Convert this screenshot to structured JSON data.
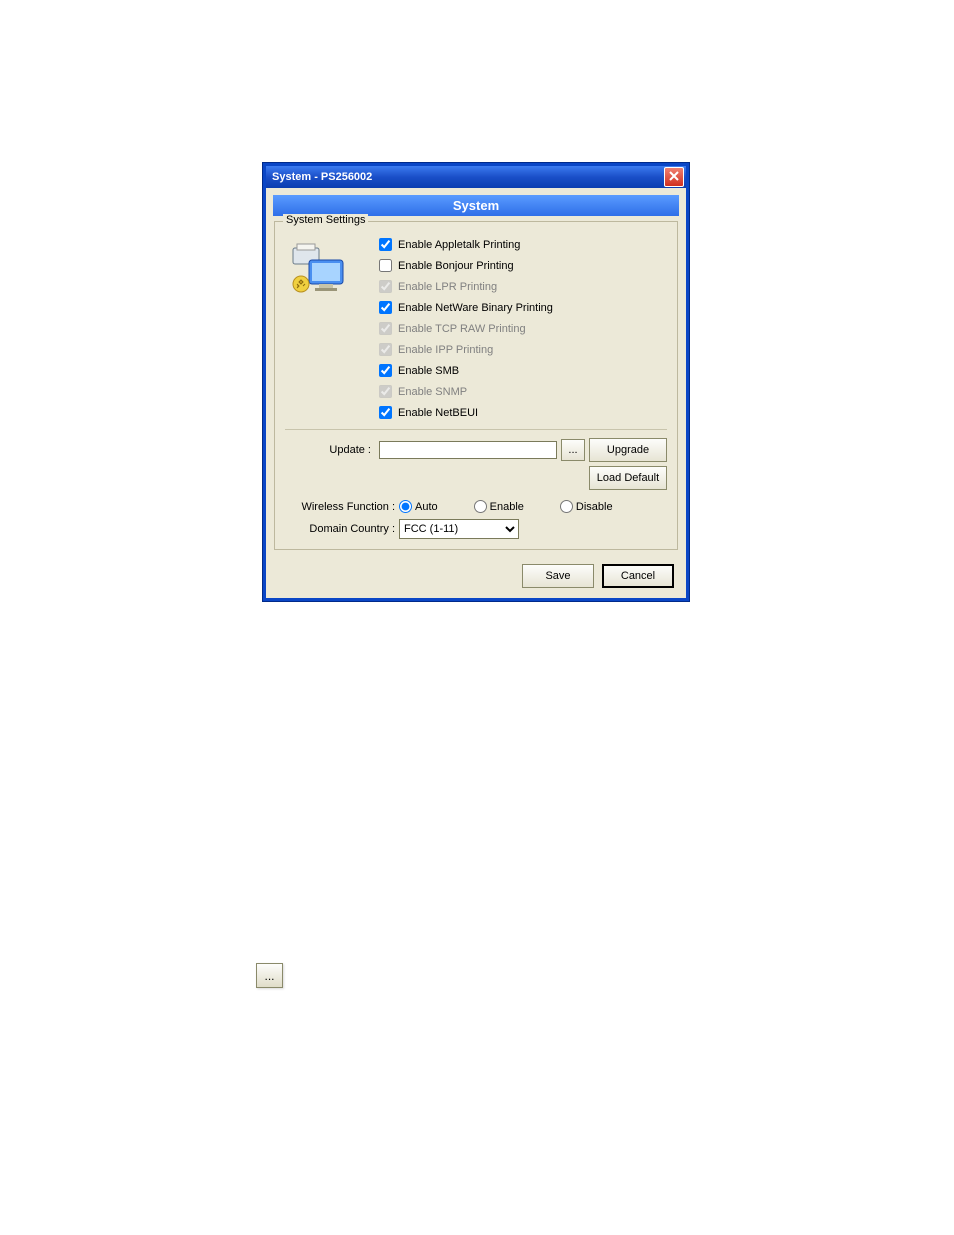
{
  "window": {
    "title": "System - PS256002",
    "banner": "System"
  },
  "group": {
    "legend": "System Settings"
  },
  "checkboxes": [
    {
      "label": "Enable Appletalk Printing",
      "checked": true,
      "disabled": false
    },
    {
      "label": "Enable Bonjour Printing",
      "checked": false,
      "disabled": false
    },
    {
      "label": "Enable LPR Printing",
      "checked": true,
      "disabled": true
    },
    {
      "label": "Enable NetWare Binary Printing",
      "checked": true,
      "disabled": false
    },
    {
      "label": "Enable TCP RAW Printing",
      "checked": true,
      "disabled": true
    },
    {
      "label": "Enable IPP Printing",
      "checked": true,
      "disabled": true
    },
    {
      "label": "Enable SMB",
      "checked": true,
      "disabled": false
    },
    {
      "label": "Enable SNMP",
      "checked": true,
      "disabled": true
    },
    {
      "label": "Enable NetBEUI",
      "checked": true,
      "disabled": false
    }
  ],
  "update": {
    "label": "Update :",
    "value": "",
    "browse": "...",
    "upgrade_btn": "Upgrade",
    "loaddefault_btn": "Load Default"
  },
  "wireless": {
    "label": "Wireless Function :",
    "options": [
      "Auto",
      "Enable",
      "Disable"
    ],
    "selected": "Auto"
  },
  "domain": {
    "label": "Domain Country :",
    "selected": "FCC (1-11)"
  },
  "footer": {
    "save": "Save",
    "cancel": "Cancel"
  },
  "floating_browse": "..."
}
